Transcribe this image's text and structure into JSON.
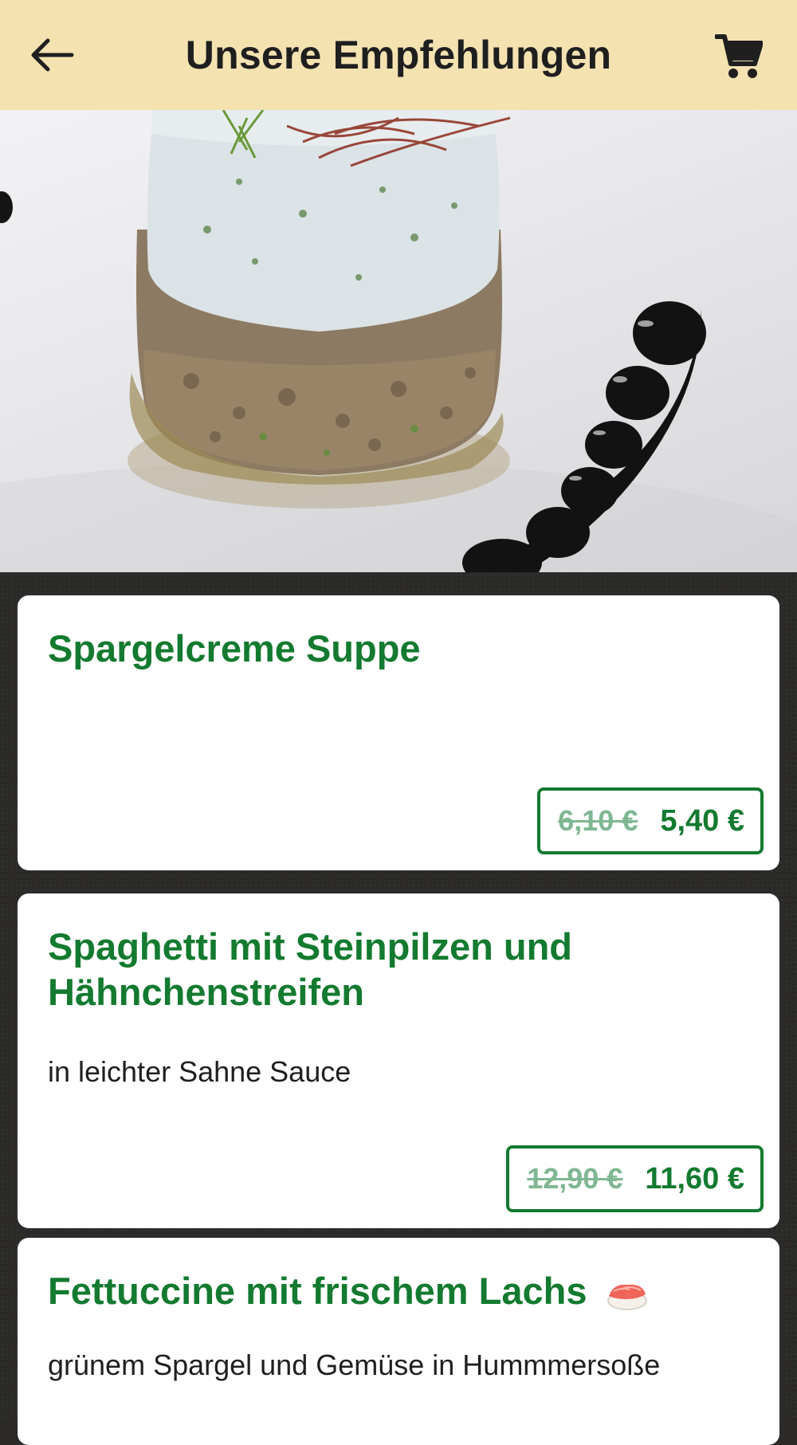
{
  "header": {
    "title": "Unsere Empfehlungen",
    "back_icon": "arrow-left-icon",
    "cart_icon": "shopping-cart-icon"
  },
  "hero": {
    "image": "recommended-dish-photo"
  },
  "colors": {
    "header_bg": "#f4e2b1",
    "accent_green": "#137a2f",
    "old_price": "#7fb792",
    "page_bg": "#2b2a29"
  },
  "items": [
    {
      "name": "Spargelcreme Suppe",
      "description": "",
      "old_price": "6,10 €",
      "price": "5,40 €"
    },
    {
      "name": "Spaghetti mit Steinpilzen und Hähnchenstreifen",
      "description": "in leichter Sahne Sauce",
      "old_price": "12,90 €",
      "price": "11,60 €"
    },
    {
      "name": "Fettuccine mit frischem Lachs",
      "name_icon": "sushi-icon",
      "description": "grünem Spargel und Gemüse in Hummmersoße"
    }
  ]
}
